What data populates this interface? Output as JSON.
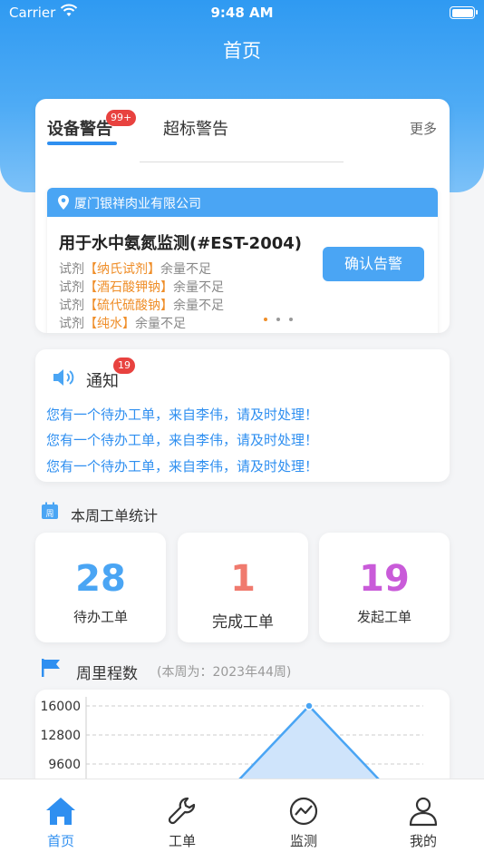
{
  "status_bar": {
    "carrier": "Carrier",
    "time": "9:48 AM"
  },
  "page_title": "首页",
  "alerts": {
    "tabs": [
      {
        "label": "设备警告",
        "badge": "99+",
        "active": true
      },
      {
        "label": "超标警告",
        "active": false
      }
    ],
    "more_label": "更多",
    "item": {
      "company": "厦门银祥肉业有限公司",
      "device": "用于水中氨氮监测(#EST-2004)",
      "confirm_label": "确认告警",
      "reagent_prefix": "试剂",
      "reagents": [
        {
          "name": "【纳氏试剂】",
          "status": "余量不足"
        },
        {
          "name": "【酒石酸钾钠】",
          "status": "余量不足"
        },
        {
          "name": "【硫代硫酸钠】",
          "status": "余量不足"
        },
        {
          "name": "【纯水】",
          "status": "余量不足"
        }
      ]
    }
  },
  "notice": {
    "title": "通知",
    "badge": "19",
    "messages": [
      "您有一个待办工单，来自李伟，请及时处理！",
      "您有一个待办工单，来自李伟，请及时处理！",
      "您有一个待办工单，来自李伟，请及时处理！"
    ]
  },
  "weekly_stats": {
    "title": "本周工单统计",
    "icon_text": "周",
    "cards": [
      {
        "value": "28",
        "label": "待办工单",
        "color": "#4aa5f4"
      },
      {
        "value": "1",
        "label": "完成工单",
        "color": "#f07a6e"
      },
      {
        "value": "19",
        "label": "发起工单",
        "color": "#c95bd9"
      }
    ]
  },
  "mileage": {
    "title": "周里程数",
    "subtitle": "(本周为：2023年44周)"
  },
  "chart_data": {
    "type": "area",
    "title": "",
    "y_ticks": [
      16000,
      12800,
      9600
    ],
    "ylim": [
      0,
      16000
    ],
    "series": [
      {
        "values": [
          0,
          16000,
          0
        ]
      }
    ],
    "grid": true,
    "color": "#4aa5f4"
  },
  "tabbar": {
    "items": [
      {
        "label": "首页",
        "icon": "home-icon",
        "active": true
      },
      {
        "label": "工单",
        "icon": "wrench-icon",
        "active": false
      },
      {
        "label": "监测",
        "icon": "monitor-icon",
        "active": false
      },
      {
        "label": "我的",
        "icon": "user-icon",
        "active": false
      }
    ],
    "active_color": "#2f8ff0"
  }
}
